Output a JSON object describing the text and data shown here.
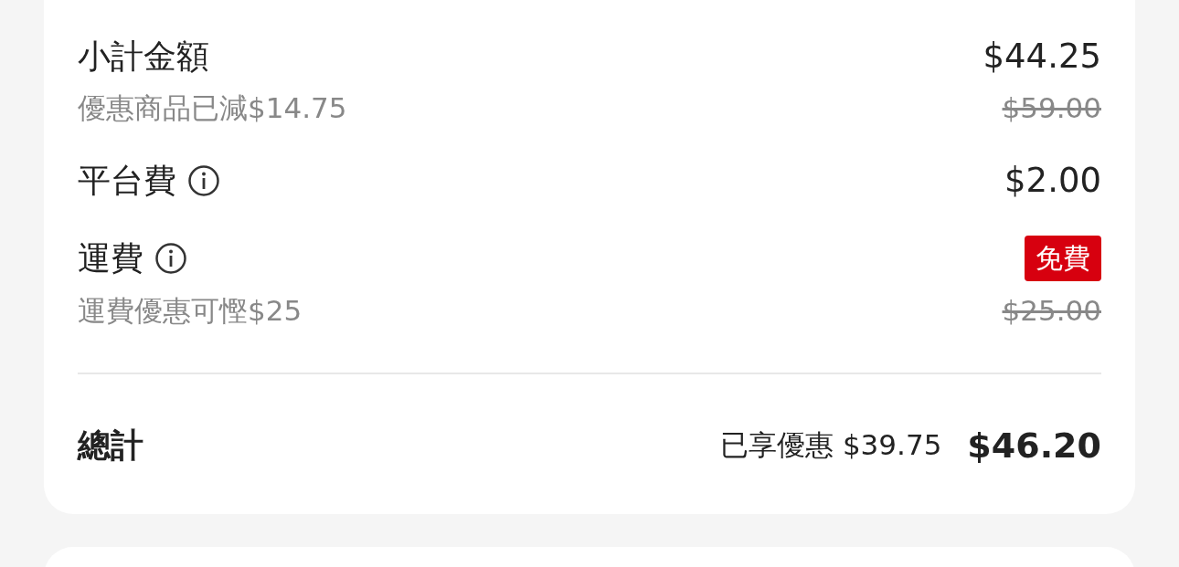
{
  "rows": [
    {
      "label": "小計金額",
      "info": false,
      "value": {
        "kind": "amount",
        "text": "$44.25"
      },
      "note": "優惠商品已減$14.75",
      "original_price": "$59.00"
    },
    {
      "label": "平台費",
      "info": true,
      "value": {
        "kind": "amount",
        "text": "$2.00"
      }
    },
    {
      "label": "運費",
      "info": true,
      "value": {
        "kind": "badge",
        "text": "免費"
      },
      "note": "運費優惠可慳$25",
      "original_price": "$25.00"
    }
  ],
  "total": {
    "label": "總計",
    "savings": "已享優惠 $39.75",
    "amount": "$46.20"
  }
}
